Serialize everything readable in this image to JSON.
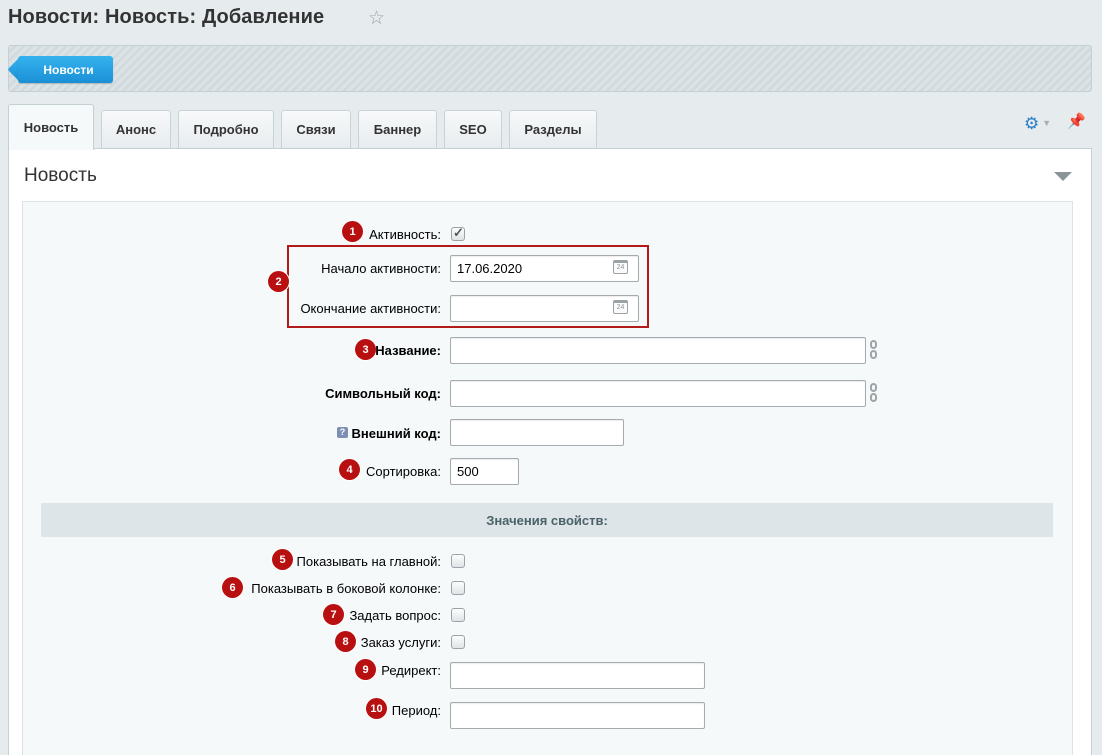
{
  "page": {
    "title": "Новости: Новость: Добавление"
  },
  "toolbar": {
    "back_label": "Новости"
  },
  "tabs": [
    {
      "label": "Новость"
    },
    {
      "label": "Анонс"
    },
    {
      "label": "Подробно"
    },
    {
      "label": "Связи"
    },
    {
      "label": "Баннер"
    },
    {
      "label": "SEO"
    },
    {
      "label": "Разделы"
    }
  ],
  "section": {
    "title": "Новость"
  },
  "form": {
    "active": {
      "label": "Активность:",
      "checked": true,
      "badge": "1"
    },
    "period_badge": "2",
    "active_from": {
      "label": "Начало активности:",
      "value": "17.06.2020"
    },
    "active_to": {
      "label": "Окончание активности:",
      "value": ""
    },
    "calendar_day": "24",
    "name": {
      "label": "Название:",
      "value": "",
      "badge": "3"
    },
    "code": {
      "label": "Символьный код:",
      "value": ""
    },
    "external_code": {
      "label": "Внешний код:",
      "value": "",
      "help": "?"
    },
    "sort": {
      "label": "Сортировка:",
      "value": "500",
      "badge": "4"
    }
  },
  "properties": {
    "header": "Значения свойств:",
    "show_main": {
      "label": "Показывать на главной:",
      "badge": "5",
      "checked": false
    },
    "show_sidebar": {
      "label": "Показывать в боковой колонке:",
      "badge": "6",
      "checked": false
    },
    "ask_question": {
      "label": "Задать вопрос:",
      "badge": "7",
      "checked": false
    },
    "order_service": {
      "label": "Заказ услуги:",
      "badge": "8",
      "checked": false
    },
    "redirect": {
      "label": "Редирект:",
      "badge": "9",
      "value": ""
    },
    "period": {
      "label": "Период:",
      "badge": "10",
      "value": ""
    }
  },
  "colors": {
    "accent": "#1b8fd6",
    "badge": "#b80f10",
    "frame": "#b31b1b"
  }
}
